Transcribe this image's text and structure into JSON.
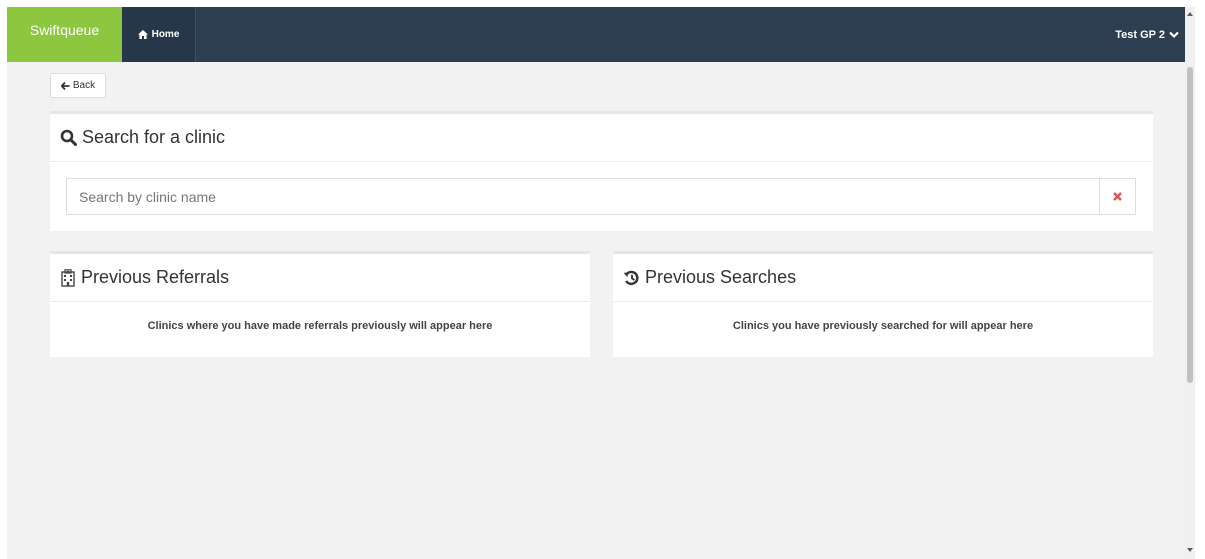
{
  "navbar": {
    "brand": "Swiftqueue",
    "home_label": "Home",
    "user_name": "Test GP 2"
  },
  "back_label": "Back",
  "search_panel": {
    "title": "Search for a clinic",
    "placeholder": "Search by clinic name",
    "value": ""
  },
  "referrals_panel": {
    "title": "Previous Referrals",
    "empty_message": "Clinics where you have made referrals previously will appear here"
  },
  "searches_panel": {
    "title": "Previous Searches",
    "empty_message": "Clinics you have previously searched for will appear here"
  },
  "colors": {
    "brand_green": "#8dc63f",
    "navbar_dark": "#2c3e50",
    "clear_red": "#d9534f",
    "page_bg": "#f2f2f2"
  }
}
